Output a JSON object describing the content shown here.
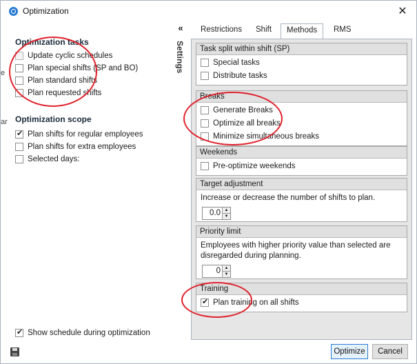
{
  "window": {
    "title": "Optimization",
    "close_glyph": "✕"
  },
  "left": {
    "tasks_title": "Optimization tasks",
    "tasks": [
      {
        "label": "Update cyclic schedules",
        "checked": false,
        "disabled": true
      },
      {
        "label": "Plan special shifts (SP and BO)",
        "checked": false,
        "disabled": false
      },
      {
        "label": "Plan standard shifts",
        "checked": false,
        "disabled": false
      },
      {
        "label": "Plan requested shifts",
        "checked": false,
        "disabled": false
      }
    ],
    "scope_title": "Optimization scope",
    "scope": [
      {
        "label": "Plan shifts for regular employees",
        "checked": true
      },
      {
        "label": "Plan shifts for extra employees",
        "checked": false
      },
      {
        "label": "Selected days:",
        "checked": false
      }
    ],
    "show_schedule_label": "Show schedule during optimization",
    "bg_fragment_1": "e",
    "bg_fragment_2": "ar"
  },
  "settings": {
    "collapse_glyph": "«",
    "vertical_label": "Settings"
  },
  "tabs": [
    "Restrictions",
    "Shift",
    "Methods",
    "RMS"
  ],
  "active_tab": "Methods",
  "groups": {
    "task_split": {
      "header": "Task split within shift (SP)",
      "items": [
        "Special tasks",
        "Distribute tasks"
      ]
    },
    "breaks": {
      "header": "Breaks",
      "items": [
        "Generate Breaks",
        "Optimize all breaks",
        "Minimize simultaneous breaks"
      ]
    },
    "weekends": {
      "header": "Weekends",
      "items": [
        "Pre-optimize weekends"
      ]
    },
    "target": {
      "header": "Target adjustment",
      "description": "Increase or decrease the number of shifts to plan.",
      "value": "0.0"
    },
    "priority": {
      "header": "Priority limit",
      "description": "Employees with higher priority value than selected are disregarded during planning.",
      "value": "0"
    },
    "training": {
      "header": "Training",
      "items": [
        "Plan training on all shifts"
      ],
      "checked": true
    }
  },
  "footer": {
    "optimize_label": "Optimize",
    "cancel_label": "Cancel"
  },
  "colors": {
    "accent": "#2b7cd3",
    "annotation": "#e0202a"
  },
  "icons": {
    "app": "app-icon",
    "save": "save-icon"
  }
}
